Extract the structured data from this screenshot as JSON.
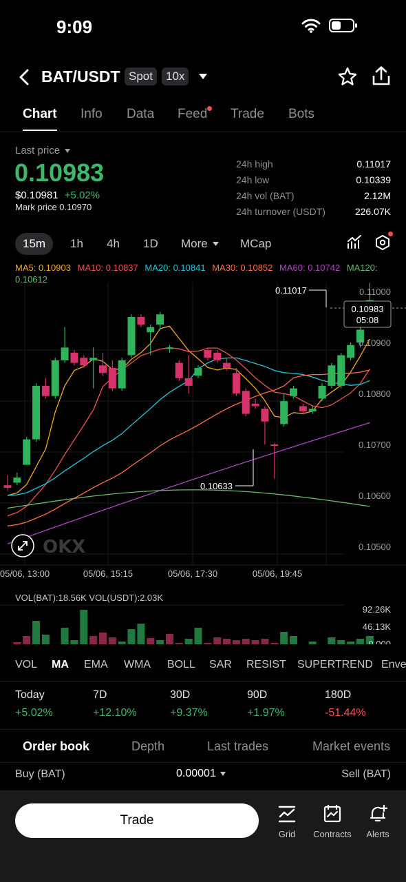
{
  "status": {
    "time": "9:09"
  },
  "header": {
    "pair": "BAT/USDT",
    "market_type": "Spot",
    "leverage": "10x"
  },
  "tabs": [
    "Chart",
    "Info",
    "Data",
    "Feed",
    "Trade",
    "Bots"
  ],
  "price": {
    "label": "Last price",
    "last": "0.10983",
    "usd": "$0.10981",
    "change": "+5.02%",
    "mark": "Mark price 0.10970"
  },
  "stats": [
    {
      "label": "24h high",
      "value": "0.11017"
    },
    {
      "label": "24h low",
      "value": "0.10339"
    },
    {
      "label": "24h vol (BAT)",
      "value": "2.12M"
    },
    {
      "label": "24h turnover (USDT)",
      "value": "226.07K"
    }
  ],
  "intervals": [
    "15m",
    "1h",
    "4h",
    "1D",
    "More",
    "MCap"
  ],
  "ma_legend": [
    {
      "text": "MA5: 0.10903",
      "color": "#f5a623"
    },
    {
      "text": "MA10: 0.10837",
      "color": "#ef5350"
    },
    {
      "text": "MA20: 0.10841",
      "color": "#26c6da"
    },
    {
      "text": "MA30: 0.10852",
      "color": "#ff7043"
    },
    {
      "text": "MA60: 0.10742",
      "color": "#ab47bc"
    },
    {
      "text": "MA120: 0.10612",
      "color": "#66bb6a"
    }
  ],
  "chart_labels": {
    "current_price": "0.10983",
    "countdown": "05:08",
    "high_marker": "0.11017",
    "low_marker": "0.10633",
    "volume_header": "VOL(BAT):18.56K VOL(USDT):2.03K",
    "watermark": "OKX"
  },
  "chart_data": {
    "type": "candlestick",
    "y_ticks": [
      "0.11000",
      "0.10900",
      "0.10800",
      "0.10700",
      "0.10600",
      "0.10500"
    ],
    "x_ticks": [
      "05/06, 13:00",
      "05/06, 15:15",
      "05/06, 17:30",
      "05/06, 19:45"
    ],
    "volume_ticks": [
      "92.26K",
      "46.13K",
      "0.000"
    ],
    "candles": [
      [
        0.1062,
        0.1064,
        0.10615,
        0.1061
      ],
      [
        0.10625,
        0.10645,
        0.10635,
        0.1062
      ],
      [
        0.1066,
        0.10715,
        0.1071,
        0.1066
      ],
      [
        0.1071,
        0.1082,
        0.10815,
        0.10705
      ],
      [
        0.10815,
        0.1083,
        0.10795,
        0.1079
      ],
      [
        0.10795,
        0.1087,
        0.10865,
        0.1079
      ],
      [
        0.10865,
        0.1093,
        0.1089,
        0.1086
      ],
      [
        0.1088,
        0.10885,
        0.1086,
        0.10855
      ],
      [
        0.1087,
        0.10875,
        0.10855,
        0.1085
      ],
      [
        0.10865,
        0.1089,
        0.1087,
        0.1081
      ],
      [
        0.10855,
        0.1088,
        0.1084,
        0.10835
      ],
      [
        0.1085,
        0.10865,
        0.1081,
        0.10805
      ],
      [
        0.1081,
        0.1087,
        0.10865,
        0.10805
      ],
      [
        0.10875,
        0.10955,
        0.1095,
        0.1087
      ],
      [
        0.1095,
        0.10955,
        0.10935,
        0.1093
      ],
      [
        0.1092,
        0.10935,
        0.1093,
        0.10875
      ],
      [
        0.10935,
        0.1096,
        0.10955,
        0.10925
      ],
      [
        0.1089,
        0.10895,
        0.1089,
        0.1088
      ],
      [
        0.1086,
        0.10865,
        0.1083,
        0.10825
      ],
      [
        0.1083,
        0.10875,
        0.10815,
        0.108
      ],
      [
        0.10835,
        0.10855,
        0.1085,
        0.1083
      ],
      [
        0.10885,
        0.1089,
        0.1087,
        0.10865
      ],
      [
        0.1088,
        0.10885,
        0.10865,
        0.1086
      ],
      [
        0.1086,
        0.1087,
        0.1085,
        0.10845
      ],
      [
        0.1084,
        0.1085,
        0.108,
        0.10795
      ],
      [
        0.10805,
        0.1081,
        0.1076,
        0.10755
      ],
      [
        0.1078,
        0.1079,
        0.10775,
        0.1077
      ],
      [
        0.1077,
        0.10775,
        0.10745,
        0.107
      ],
      [
        0.107,
        0.10703,
        0.10697,
        0.10633
      ],
      [
        0.1074,
        0.108,
        0.10785,
        0.10735
      ],
      [
        0.10795,
        0.10815,
        0.1081,
        0.1079
      ],
      [
        0.10775,
        0.1078,
        0.10765,
        0.1076
      ],
      [
        0.10765,
        0.10775,
        0.1077,
        0.1076
      ],
      [
        0.1079,
        0.1082,
        0.10815,
        0.10785
      ],
      [
        0.10815,
        0.1086,
        0.10855,
        0.1081
      ],
      [
        0.10815,
        0.1088,
        0.10875,
        0.1081
      ],
      [
        0.1087,
        0.109,
        0.10895,
        0.10865
      ],
      [
        0.109,
        0.1093,
        0.10925,
        0.1089
      ],
      [
        0.1094,
        0.11017,
        0.10983,
        0.1093
      ]
    ],
    "volumes": [
      3,
      9,
      18,
      40,
      20,
      5,
      30,
      12,
      56,
      18,
      23,
      16,
      10,
      28,
      36,
      15,
      12,
      21,
      8,
      14,
      30,
      8,
      16,
      14,
      12,
      14,
      12,
      14,
      8,
      24,
      18,
      6,
      10,
      4,
      16,
      12,
      10,
      14,
      18
    ],
    "volume_colors": [
      "g",
      "r",
      "r",
      "g",
      "g",
      "r",
      "g",
      "g",
      "g",
      "r",
      "r",
      "r",
      "g",
      "g",
      "g",
      "r",
      "g",
      "r",
      "r",
      "g",
      "g",
      "r",
      "r",
      "r",
      "r",
      "r",
      "r",
      "r",
      "r",
      "g",
      "g",
      "r",
      "g",
      "g",
      "g",
      "g",
      "g",
      "g",
      "g"
    ]
  },
  "indicators": [
    "VOL",
    "MA",
    "EMA",
    "WMA",
    "BOLL",
    "SAR",
    "RESIST",
    "SUPERTREND",
    "Enve"
  ],
  "performance": [
    {
      "label": "Today",
      "value": "+5.02%",
      "dir": "up"
    },
    {
      "label": "7D",
      "value": "+12.10%",
      "dir": "up"
    },
    {
      "label": "30D",
      "value": "+9.37%",
      "dir": "up"
    },
    {
      "label": "90D",
      "value": "+1.97%",
      "dir": "up"
    },
    {
      "label": "180D",
      "value": "-51.44%",
      "dir": "down"
    }
  ],
  "order_tabs": [
    "Order book",
    "Depth",
    "Last trades",
    "Market events"
  ],
  "order_book": {
    "buy_label": "Buy (BAT)",
    "precision": "0.00001",
    "sell_label": "Sell (BAT)"
  },
  "bottom_bar": {
    "trade": "Trade",
    "grid": "Grid",
    "contracts": "Contracts",
    "alerts": "Alerts"
  }
}
